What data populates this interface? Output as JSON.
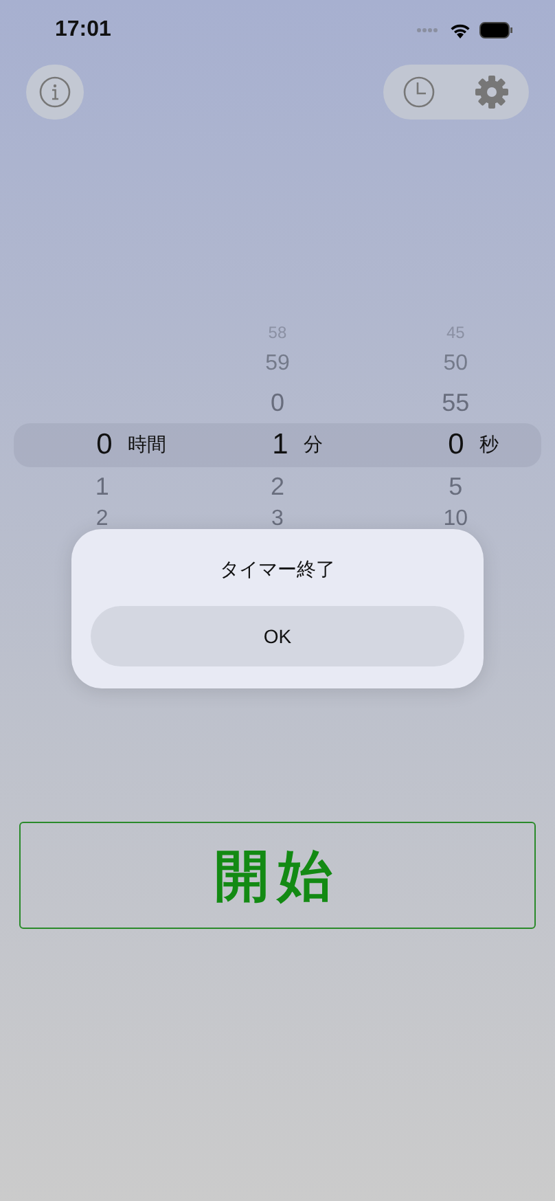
{
  "status_bar": {
    "time": "17:01"
  },
  "picker": {
    "columns": [
      {
        "unit": "時間",
        "value": "0",
        "below": [
          "1",
          "2"
        ]
      },
      {
        "unit": "分",
        "value": "1",
        "above": [
          "58",
          "59",
          "0"
        ],
        "below": [
          "2",
          "3"
        ]
      },
      {
        "unit": "秒",
        "value": "0",
        "above": [
          "45",
          "50",
          "55"
        ],
        "below": [
          "5",
          "10"
        ]
      }
    ]
  },
  "alert": {
    "title": "タイマー終了",
    "button": "OK"
  },
  "start_button": {
    "label": "開始"
  }
}
